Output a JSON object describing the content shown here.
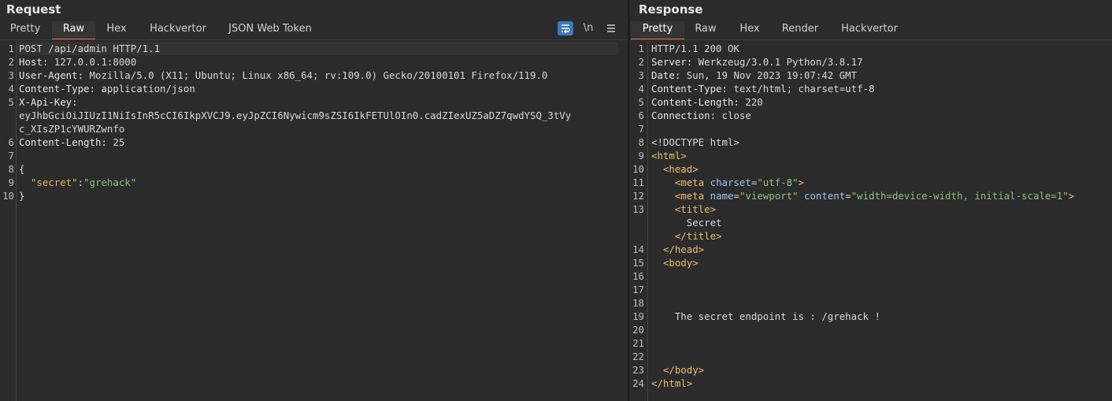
{
  "request": {
    "title": "Request",
    "tabs": [
      "Pretty",
      "Raw",
      "Hex",
      "Hackvertor",
      "JSON Web Token"
    ],
    "active_tab": "Raw",
    "tools": {
      "wrap_icon": "wrap-lines-icon",
      "newline_label": "\\n",
      "menu_icon": "hamburger-menu-icon"
    },
    "lines": [
      {
        "n": "1",
        "text": "POST /api/admin HTTP/1.1"
      },
      {
        "n": "2",
        "key": "Host:",
        "val": " 127.0.0.1:8000"
      },
      {
        "n": "3",
        "key": "User-Agent:",
        "val": " Mozilla/5.0 (X11; Ubuntu; Linux x86_64; rv:109.0) Gecko/20100101 Firefox/119.0"
      },
      {
        "n": "4",
        "key": "Content-Type:",
        "val": " application/json"
      },
      {
        "n": "5",
        "key": "X-Api-Key:",
        "val": ""
      },
      {
        "n": "",
        "text": "eyJhbGciOiJIUzI1NiIsInR5cCI6IkpXVCJ9.eyJpZCI6Nywicm9sZSI6IkFETUlOIn0.cadZIexUZ5aDZ7qwdYSQ_3tVy"
      },
      {
        "n": "",
        "text": "c_XIsZP1cYWURZwnfo"
      },
      {
        "n": "6",
        "key": "Content-Length:",
        "val": " 25"
      },
      {
        "n": "7",
        "text": ""
      },
      {
        "n": "8",
        "text": "{"
      },
      {
        "n": "9",
        "json_key": "\"secret\"",
        "json_sep": ":",
        "json_val": "\"grehack\""
      },
      {
        "n": "10",
        "text": "}"
      }
    ]
  },
  "response": {
    "title": "Response",
    "tabs": [
      "Pretty",
      "Raw",
      "Hex",
      "Render",
      "Hackvertor"
    ],
    "active_tab": "Pretty",
    "lines": [
      {
        "n": "1",
        "text": "HTTP/1.1 200 OK"
      },
      {
        "n": "2",
        "key": "Server:",
        "val": " Werkzeug/3.0.1 Python/3.8.17"
      },
      {
        "n": "3",
        "key": "Date:",
        "val": " Sun, 19 Nov 2023 19:07:42 GMT"
      },
      {
        "n": "4",
        "key": "Content-Type:",
        "val": " text/html; charset=utf-8"
      },
      {
        "n": "5",
        "key": "Content-Length:",
        "val": " 220"
      },
      {
        "n": "6",
        "key": "Connection:",
        "val": " close"
      },
      {
        "n": "7",
        "text": ""
      },
      {
        "n": "8",
        "text": "<!DOCTYPE html>"
      },
      {
        "n": "9",
        "html": "<span class='tag'>&lt;html&gt;</span>"
      },
      {
        "n": "10",
        "html": "  <span class='tag'>&lt;head&gt;</span>"
      },
      {
        "n": "11",
        "html": "    <span class='tag'>&lt;meta</span> <span class='attr'>charset</span>=<span class='str'>\"utf-8\"</span><span class='tag'>&gt;</span>"
      },
      {
        "n": "12",
        "html": "    <span class='tag'>&lt;meta</span> <span class='attr'>name</span>=<span class='str'>\"viewport\"</span> <span class='attr'>content</span>=<span class='str'>\"width=device-width, initial-scale=1\"</span><span class='tag'>&gt;</span>"
      },
      {
        "n": "13",
        "html": "    <span class='tag'>&lt;title&gt;</span>"
      },
      {
        "n": "",
        "text": "      Secret"
      },
      {
        "n": "",
        "html": "    <span class='tag'>&lt;/title&gt;</span>"
      },
      {
        "n": "14",
        "html": "  <span class='tag'>&lt;/head&gt;</span>"
      },
      {
        "n": "15",
        "html": "  <span class='tag'>&lt;body&gt;</span>"
      },
      {
        "n": "16",
        "text": ""
      },
      {
        "n": "17",
        "text": ""
      },
      {
        "n": "18",
        "text": ""
      },
      {
        "n": "19",
        "text": "    The secret endpoint is : /grehack !"
      },
      {
        "n": "20",
        "text": ""
      },
      {
        "n": "21",
        "text": ""
      },
      {
        "n": "22",
        "text": ""
      },
      {
        "n": "23",
        "html": "  <span class='tag'>&lt;/body&gt;</span>"
      },
      {
        "n": "24",
        "html": "<span class='tag'>&lt;/html&gt;</span>"
      }
    ]
  }
}
